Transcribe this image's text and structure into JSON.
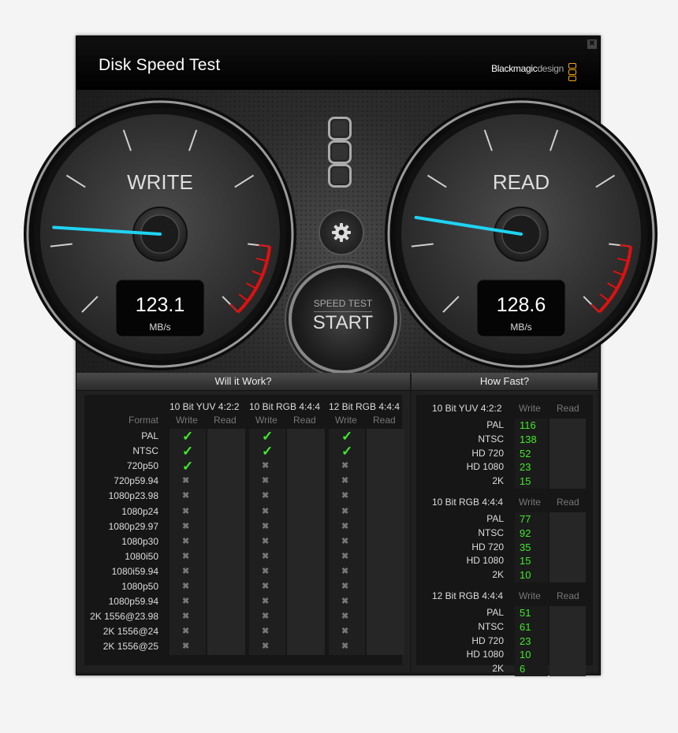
{
  "window": {
    "title": "Disk Speed Test",
    "brand_primary": "Blackmagic",
    "brand_secondary": "design",
    "close_glyph": "✖"
  },
  "gauges": {
    "write": {
      "label": "WRITE",
      "value": "123.1",
      "unit": "MB/s",
      "needle_fraction": 0.18
    },
    "read": {
      "label": "READ",
      "value": "128.6",
      "unit": "MB/s",
      "needle_fraction": 0.2
    }
  },
  "settings_button": {
    "icon": "gear-icon"
  },
  "start_button": {
    "line1": "SPEED TEST",
    "line2": "START"
  },
  "will_it_work": {
    "title": "Will it Work?",
    "format_header": "Format",
    "groups": [
      {
        "name": "10 Bit YUV 4:2:2",
        "write": "Write",
        "read": "Read"
      },
      {
        "name": "10 Bit RGB 4:4:4",
        "write": "Write",
        "read": "Read"
      },
      {
        "name": "12 Bit RGB 4:4:4",
        "write": "Write",
        "read": "Read"
      }
    ],
    "formats": [
      "PAL",
      "NTSC",
      "720p50",
      "720p59.94",
      "1080p23.98",
      "1080p24",
      "1080p29.97",
      "1080p30",
      "1080i50",
      "1080i59.94",
      "1080p50",
      "1080p59.94",
      "2K 1556@23.98",
      "2K 1556@24",
      "2K 1556@25"
    ],
    "write_ok": [
      [
        true,
        true,
        true,
        false,
        false,
        false,
        false,
        false,
        false,
        false,
        false,
        false,
        false,
        false,
        false
      ],
      [
        true,
        true,
        false,
        false,
        false,
        false,
        false,
        false,
        false,
        false,
        false,
        false,
        false,
        false,
        false
      ],
      [
        true,
        true,
        false,
        false,
        false,
        false,
        false,
        false,
        false,
        false,
        false,
        false,
        false,
        false,
        false
      ]
    ],
    "check_glyph": "✓",
    "cross_glyph": "✖"
  },
  "how_fast": {
    "title": "How Fast?",
    "write_label": "Write",
    "read_label": "Read",
    "groups": [
      {
        "name": "10 Bit YUV 4:2:2",
        "rows": [
          [
            "PAL",
            "116"
          ],
          [
            "NTSC",
            "138"
          ],
          [
            "HD 720",
            "52"
          ],
          [
            "HD 1080",
            "23"
          ],
          [
            "2K",
            "15"
          ]
        ]
      },
      {
        "name": "10 Bit RGB 4:4:4",
        "rows": [
          [
            "PAL",
            "77"
          ],
          [
            "NTSC",
            "92"
          ],
          [
            "HD 720",
            "35"
          ],
          [
            "HD 1080",
            "15"
          ],
          [
            "2K",
            "10"
          ]
        ]
      },
      {
        "name": "12 Bit RGB 4:4:4",
        "rows": [
          [
            "PAL",
            "51"
          ],
          [
            "NTSC",
            "61"
          ],
          [
            "HD 720",
            "23"
          ],
          [
            "HD 1080",
            "10"
          ],
          [
            "2K",
            "6"
          ]
        ]
      }
    ]
  },
  "colors": {
    "accent_needle": "#1fd3f2",
    "ok_green": "#41e92a",
    "danger_red": "#e01010",
    "brand_orange": "#f3a712"
  }
}
